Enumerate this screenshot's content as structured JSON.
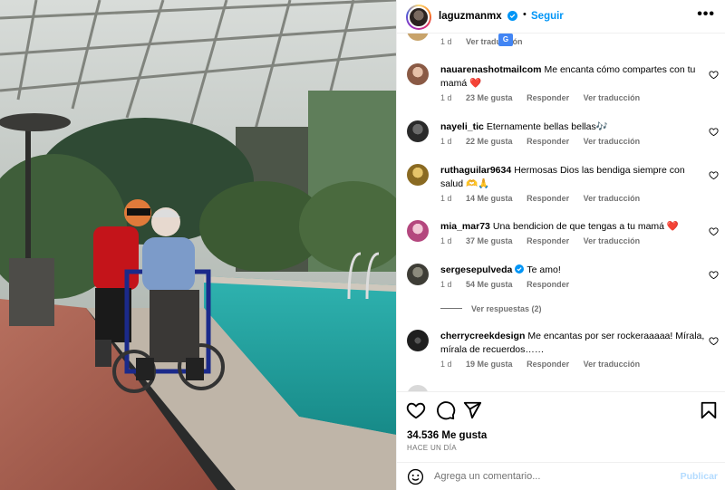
{
  "post": {
    "username": "laguzmanmx",
    "follow_label": "Seguir",
    "separator": "•",
    "more_label": "•••"
  },
  "comments": [
    {
      "user": "",
      "text": "",
      "time": "1 d",
      "likes": "",
      "reply": "",
      "translate": "Ver traducción",
      "avatar_color": "#c8a36a"
    },
    {
      "user": "nauarenashotmailcom",
      "text": "Me encanta cómo compartes con tu mamá ❤️",
      "time": "1 d",
      "likes": "23 Me gusta",
      "reply": "Responder",
      "translate": "Ver traducción",
      "avatar_color": "#b07a5f"
    },
    {
      "user": "nayeli_tic",
      "text": "Eternamente bellas bellas🎶",
      "time": "1 d",
      "likes": "22 Me gusta",
      "reply": "Responder",
      "translate": "Ver traducción",
      "avatar_color": "#3a3a3a"
    },
    {
      "user": "ruthaguilar9634",
      "text": "Hermosas Dios las bendiga siempre con salud 🫶🙏",
      "time": "1 d",
      "likes": "14 Me gusta",
      "reply": "Responder",
      "translate": "Ver traducción",
      "avatar_color": "#a07c2e"
    },
    {
      "user": "mia_mar73",
      "text": "Una bendicion de que tengas a tu mamá ❤️",
      "time": "1 d",
      "likes": "37 Me gusta",
      "reply": "Responder",
      "translate": "Ver traducción",
      "avatar_color": "#c96a9a"
    },
    {
      "user": "sergesepulveda",
      "text": "Te amo!",
      "time": "1 d",
      "likes": "54 Me gusta",
      "reply": "Responder",
      "translate": "",
      "avatar_color": "#4a4a44"
    },
    {
      "user": "cherrycreekdesign",
      "text": "Me encantas por ser rockeraaaaa! Mírala, mírala de recuerdos……",
      "time": "1 d",
      "likes": "19 Me gusta",
      "reply": "Responder",
      "translate": "Ver traducción",
      "avatar_color": "#1f1f1f"
    }
  ],
  "replies_label": "Ver respuestas (2)",
  "translate_badge": "G",
  "likes_count": "34.536 Me gusta",
  "time_ago": "HACE UN DÍA",
  "comment_box": {
    "placeholder": "Agrega un comentario...",
    "publish_label": "Publicar"
  },
  "icons": {
    "like": "heart-icon",
    "comment": "comment-icon",
    "share": "send-icon",
    "save": "bookmark-icon",
    "emoji": "smiley-icon",
    "verified": "verified-badge-icon",
    "more": "more-options-icon"
  },
  "colors": {
    "follow_blue": "#0095f6",
    "publish_disabled": "#b3dbff",
    "meta_gray": "#737373",
    "heart_red": "#ed4956",
    "verified_blue": "#0095f6"
  }
}
